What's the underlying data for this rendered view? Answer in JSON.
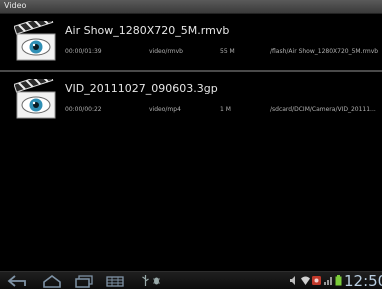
{
  "window": {
    "title": "Video"
  },
  "videos": [
    {
      "name": "Air Show_1280X720_5M.rmvb",
      "duration": "00:00/01:39",
      "type": "video/rmvb",
      "size": "55 M",
      "path": "/flash/Air Show_1280X720_5M.rmvb"
    },
    {
      "name": "VID_20111027_090603.3gp",
      "duration": "00:00/00:22",
      "type": "video/mp4",
      "size": "1 M",
      "path": "/sdcard/DCIM/Camera/VID_20111..."
    }
  ],
  "statusbar": {
    "clock": "12:50",
    "icons": [
      "back-icon",
      "home-icon",
      "recent-apps-icon",
      "menu-icon",
      "usb-icon",
      "debug-icon",
      "volume-icon",
      "wifi-icon",
      "recording-icon",
      "signal-icon",
      "battery-icon"
    ],
    "accent": "#b8cde0",
    "battery_color": "#7ccd3a"
  }
}
